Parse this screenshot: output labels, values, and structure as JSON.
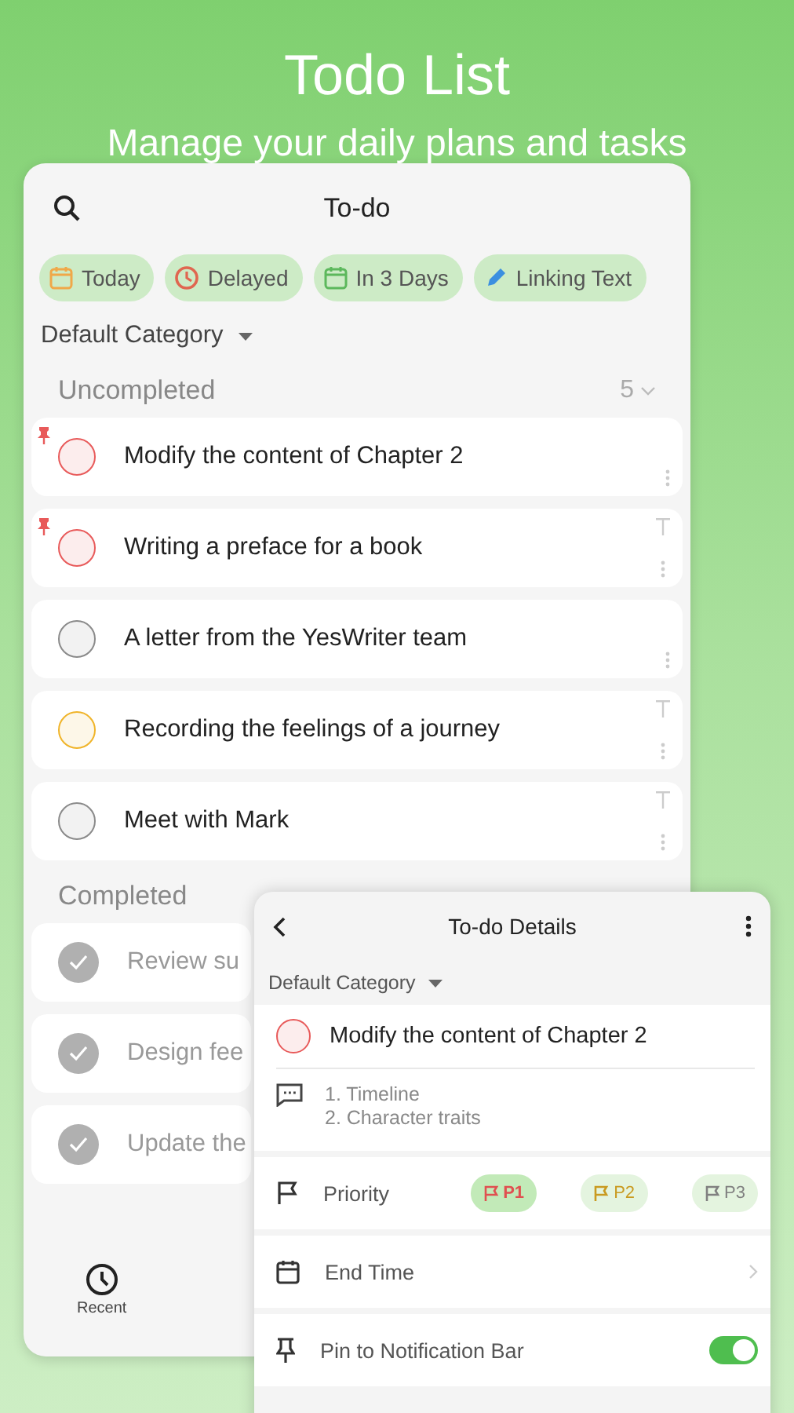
{
  "header": {
    "title": "Todo List",
    "subtitle": "Manage your daily plans and tasks"
  },
  "app": {
    "title": "To-do",
    "filters": [
      {
        "label": "Today",
        "kind": "today"
      },
      {
        "label": "Delayed",
        "kind": "delayed"
      },
      {
        "label": "In 3 Days",
        "kind": "soon"
      },
      {
        "label": "Linking Text",
        "kind": "link"
      }
    ],
    "category": "Default Category",
    "uncompleted": {
      "title": "Uncompleted",
      "count": "5",
      "items": [
        {
          "text": "Modify the content of Chapter 2",
          "pinned": true,
          "color": "#e85a5a",
          "top_button": false
        },
        {
          "text": "Writing a preface for a book",
          "pinned": true,
          "color": "#e85a5a",
          "top_button": true
        },
        {
          "text": "A letter from the YesWriter team",
          "pinned": false,
          "color": "#8a8a8a",
          "top_button": false
        },
        {
          "text": "Recording the feelings of a journey",
          "pinned": false,
          "color": "#f0b429",
          "top_button": true
        },
        {
          "text": "Meet with Mark",
          "pinned": false,
          "color": "#8a8a8a",
          "top_button": true
        }
      ]
    },
    "completed": {
      "title": "Completed",
      "items": [
        {
          "text": "Review su",
          "done": true
        },
        {
          "text": "Design fee",
          "done": true
        },
        {
          "text": "Update the",
          "done": true
        }
      ]
    },
    "nav": [
      {
        "label": "Recent",
        "selected": true
      }
    ]
  },
  "details": {
    "title": "To-do Details",
    "category": "Default Category",
    "task": {
      "text": "Modify the content of Chapter 2",
      "color": "#e85a5a"
    },
    "notes": [
      "1. Timeline",
      "2. Character traits"
    ],
    "rows": [
      {
        "kind": "priority",
        "label": "Priority",
        "options": [
          {
            "label": "P1",
            "color": "#e05050",
            "selected": true
          },
          {
            "label": "P2",
            "color": "#c99a20",
            "selected": false
          },
          {
            "label": "P3",
            "color": "#808080",
            "selected": false
          }
        ]
      },
      {
        "kind": "link",
        "label": "End Time"
      },
      {
        "kind": "toggle",
        "label": "Pin to Notification Bar",
        "on": true
      }
    ]
  }
}
